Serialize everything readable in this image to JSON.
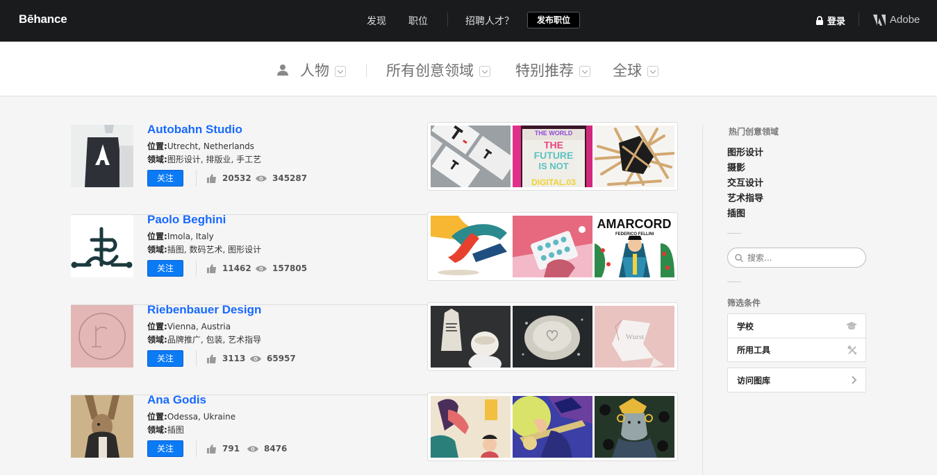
{
  "header": {
    "logo": "Bēhance",
    "nav": [
      "发现",
      "职位"
    ],
    "hire_prompt": "招聘人才？",
    "post_job_label": "发布职位",
    "login_label": "登录",
    "adobe_label": "Adobe"
  },
  "filters": {
    "people": "人物",
    "fields": "所有创意领域",
    "featured": "特别推荐",
    "location": "全球"
  },
  "labels": {
    "location": "位置:",
    "field": "领域:",
    "follow": "关注"
  },
  "creators": [
    {
      "name": "Autobahn Studio",
      "location": "Utrecht, Netherlands",
      "fields": "图形设计, 排版业, 手工艺",
      "appreciations": "20532",
      "views": "345287"
    },
    {
      "name": "Paolo Beghini",
      "location": "Imola, Italy",
      "fields": "插图, 数码艺术, 图形设计",
      "appreciations": "11462",
      "views": "157805"
    },
    {
      "name": "Riebenbauer Design",
      "location": "Vienna, Austria",
      "fields": "品牌推广, 包装, 艺术指导",
      "appreciations": "3113",
      "views": "65957"
    },
    {
      "name": "Ana Godis",
      "location": "Odessa, Ukraine",
      "fields": "插图",
      "appreciations": "791",
      "views": "8476"
    }
  ],
  "thumb_text": {
    "future": [
      "THE WORLD",
      "THE",
      "FUTURE",
      "IS NOT",
      "DIGITAL.03"
    ],
    "amarcord": "AMARCORD",
    "fellini": "FEDERICO FELLINI",
    "wurst": "Wurst"
  },
  "sidebar": {
    "popular_heading": "热门创意领域",
    "popular": [
      "图形设计",
      "摄影",
      "交互设计",
      "艺术指导",
      "插图"
    ],
    "search_placeholder": "搜索...",
    "filter_heading": "筛选条件",
    "filter_items": [
      "学校",
      "所用工具"
    ],
    "visit_gallery": "访问图库"
  },
  "colors": {
    "accent": "#1769ff",
    "follow_button": "#0a7af5",
    "topbar": "#1a1b1d"
  }
}
